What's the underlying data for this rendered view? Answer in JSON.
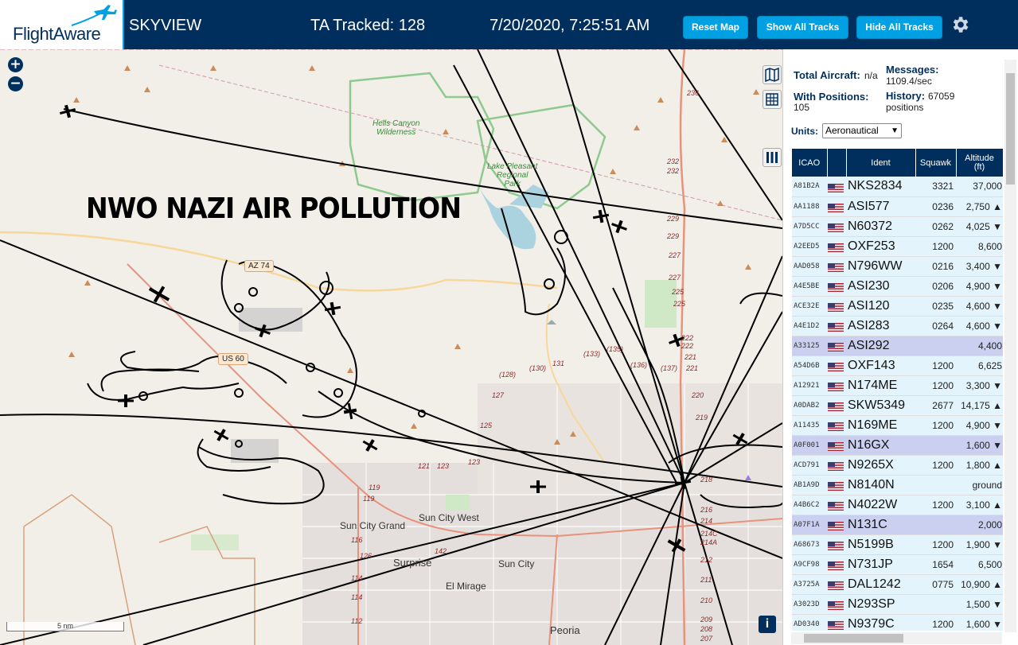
{
  "header": {
    "logo_text": "FlightAware",
    "app_title": "SKYVIEW",
    "tracked_label": "TA Tracked: 128",
    "datetime": "7/20/2020, 7:25:51 AM",
    "reset_map_label": "Reset Map",
    "show_all_label": "Show All Tracks",
    "hide_all_label": "Hide All Tracks",
    "settings_icon": "gear-icon"
  },
  "map": {
    "overlay_text": "NWO NAZI AIR POLLUTION",
    "zoom_in": "+",
    "zoom_out": "−",
    "scale": "5 nm",
    "info_label": "i",
    "park_labels": {
      "hells_canyon_1": "Hells Canyon",
      "hells_canyon_2": "Wilderness",
      "lake_pleasant_1": "Lake Pleasant",
      "lake_pleasant_2": "Regional",
      "lake_pleasant_3": "Park"
    },
    "places": {
      "sun_city_grand": "Sun City Grand",
      "sun_city_west": "Sun City West",
      "surprise": "Surprise",
      "sun_city": "Sun City",
      "el_mirage": "El Mirage",
      "peoria": "Peoria"
    },
    "highways": {
      "az74": "AZ 74",
      "us60": "US 60"
    },
    "mile_markers": [
      "236",
      "232",
      "232",
      "229",
      "229",
      "227",
      "227",
      "225",
      "225",
      "222",
      "222",
      "221",
      "221",
      "220",
      "219",
      "218",
      "216",
      "214",
      "214C",
      "214A",
      "212",
      "211",
      "210",
      "209",
      "208",
      "207",
      "131",
      "(133)",
      "(135)",
      "(136)",
      "(137)",
      "(130)",
      "(128)",
      "127",
      "125",
      "123",
      "123",
      "121",
      "119",
      "119",
      "116",
      "114",
      "114",
      "112",
      "126",
      "142"
    ]
  },
  "stats": {
    "total_label": "Total Aircraft:",
    "total_value": "n/a",
    "positions_label": "With Positions:",
    "positions_value": "105",
    "messages_label": "Messages:",
    "messages_value": "1109.4/sec",
    "history_label": "History:",
    "history_value": "67059",
    "history_unit": "positions",
    "units_label": "Units:",
    "units_value": "Aeronautical"
  },
  "table": {
    "columns": {
      "icao": "ICAO",
      "ident": "Ident",
      "squawk": "Squawk",
      "altitude_1": "Altitude",
      "altitude_2": "(ft)"
    },
    "rows": [
      {
        "icao": "A81B2A",
        "ident": "NKS2834",
        "squawk": "3321",
        "alt": "37,000",
        "sel": false
      },
      {
        "icao": "AA1188",
        "ident": "ASI577",
        "squawk": "0236",
        "alt": "2,750 ▲",
        "sel": false
      },
      {
        "icao": "A7D5CC",
        "ident": "N60372",
        "squawk": "0262",
        "alt": "4,025 ▼",
        "sel": false
      },
      {
        "icao": "A2EED5",
        "ident": "OXF253",
        "squawk": "1200",
        "alt": "8,600",
        "sel": false
      },
      {
        "icao": "AAD058",
        "ident": "N796WW",
        "squawk": "0216",
        "alt": "3,400 ▼",
        "sel": false
      },
      {
        "icao": "A4E5BE",
        "ident": "ASI230",
        "squawk": "0206",
        "alt": "4,900 ▼",
        "sel": false
      },
      {
        "icao": "ACE32E",
        "ident": "ASI120",
        "squawk": "0235",
        "alt": "4,600 ▼",
        "sel": false
      },
      {
        "icao": "A4E1D2",
        "ident": "ASI283",
        "squawk": "0264",
        "alt": "4,600 ▼",
        "sel": false
      },
      {
        "icao": "A33125",
        "ident": "ASI292",
        "squawk": "",
        "alt": "4,400",
        "sel": true
      },
      {
        "icao": "A54D6B",
        "ident": "OXF143",
        "squawk": "1200",
        "alt": "6,625",
        "sel": false
      },
      {
        "icao": "A12921",
        "ident": "N174ME",
        "squawk": "1200",
        "alt": "3,300 ▼",
        "sel": false
      },
      {
        "icao": "A0DAB2",
        "ident": "SKW5349",
        "squawk": "2677",
        "alt": "14,175 ▲",
        "sel": false
      },
      {
        "icao": "A11435",
        "ident": "N169ME",
        "squawk": "1200",
        "alt": "4,900 ▼",
        "sel": false
      },
      {
        "icao": "A0F001",
        "ident": "N16GX",
        "squawk": "",
        "alt": "1,600 ▼",
        "sel": true
      },
      {
        "icao": "ACD791",
        "ident": "N9265X",
        "squawk": "1200",
        "alt": "1,800 ▲",
        "sel": false
      },
      {
        "icao": "AB1A9D",
        "ident": "N8140N",
        "squawk": "",
        "alt": "ground",
        "sel": false
      },
      {
        "icao": "A4B6C2",
        "ident": "N4022W",
        "squawk": "1200",
        "alt": "3,100 ▲",
        "sel": false
      },
      {
        "icao": "A07F1A",
        "ident": "N131C",
        "squawk": "",
        "alt": "2,000",
        "sel": true
      },
      {
        "icao": "A68673",
        "ident": "N5199B",
        "squawk": "1200",
        "alt": "1,900 ▼",
        "sel": false
      },
      {
        "icao": "A9CF98",
        "ident": "N731JP",
        "squawk": "1654",
        "alt": "6,500",
        "sel": false
      },
      {
        "icao": "A3725A",
        "ident": "DAL1242",
        "squawk": "0775",
        "alt": "10,900 ▲",
        "sel": false
      },
      {
        "icao": "A3023D",
        "ident": "N293SP",
        "squawk": "",
        "alt": "1,500 ▼",
        "sel": false
      },
      {
        "icao": "AD0340",
        "ident": "N9379C",
        "squawk": "1200",
        "alt": "1,600 ▼",
        "sel": false
      }
    ]
  },
  "colors": {
    "header_bg": "#002f5d",
    "button_bg": "#00a0e2",
    "row_bg": "#e3f4fc",
    "row_selected_bg": "#ccd0f0"
  }
}
